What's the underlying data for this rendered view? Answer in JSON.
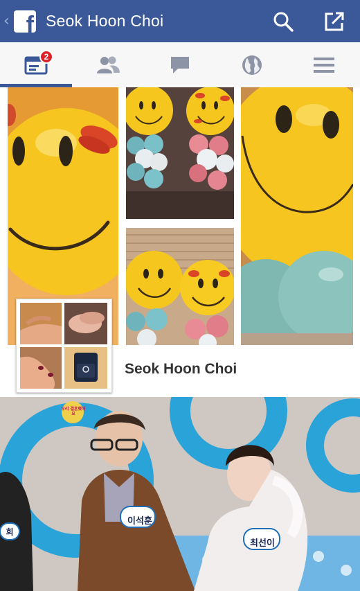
{
  "app": {
    "title": "Seok Hoon Choi",
    "brand_color": "#3b5998",
    "logo_glyph": "f"
  },
  "topbar": {
    "back_glyph": "‹",
    "search_icon": "search-icon",
    "share_icon": "share-external-icon"
  },
  "tabs": [
    {
      "name": "news-feed",
      "icon": "news-feed-icon",
      "badge": "2",
      "active": true
    },
    {
      "name": "friends",
      "icon": "friends-icon",
      "active": false
    },
    {
      "name": "messages",
      "icon": "chat-bubble-icon",
      "active": false
    },
    {
      "name": "notifications",
      "icon": "globe-icon",
      "active": false
    },
    {
      "name": "menu",
      "icon": "hamburger-menu-icon",
      "active": false
    }
  ],
  "profile": {
    "name": "Seok Hoon Choi"
  },
  "cover": {
    "name_tag_left": "이석훈",
    "name_tag_right": "최선이",
    "name_tag_edge": "희",
    "show_logo": "우리 결혼했어요"
  }
}
